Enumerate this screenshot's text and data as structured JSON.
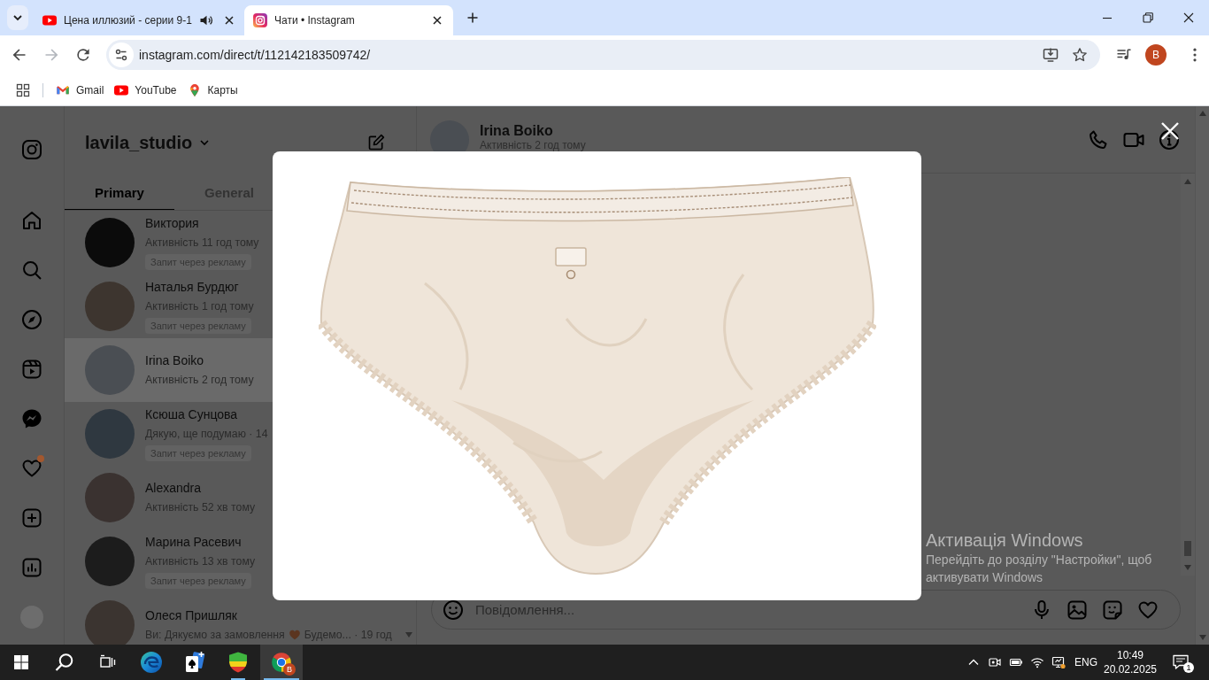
{
  "browser": {
    "tabs": [
      {
        "title": "Цена иллюзий - серии 9-1",
        "kind": "video",
        "audio": true,
        "selected": false
      },
      {
        "title": "Чати • Instagram",
        "kind": "photo",
        "audio": false,
        "selected": true
      }
    ],
    "nav": [
      {
        "kind": "back",
        "disabled": false
      },
      {
        "kind": "forward",
        "disabled": true
      },
      {
        "kind": "reload",
        "disabled": false
      }
    ],
    "address": "instagram.com/direct/t/112142183509742/",
    "profile_initial": "B",
    "bookmarks": [
      {
        "label": "Gmail",
        "kind": "mail"
      },
      {
        "label": "YouTube",
        "kind": "video"
      },
      {
        "label": "Карты",
        "kind": "map"
      }
    ]
  },
  "instagram": {
    "nav": [
      {
        "kind": "logo",
        "dot": false
      },
      {
        "kind": "home",
        "dot": false
      },
      {
        "kind": "search",
        "dot": false
      },
      {
        "kind": "explore",
        "dot": false
      },
      {
        "kind": "reels",
        "dot": false
      },
      {
        "kind": "messages",
        "dot": false
      },
      {
        "kind": "notifications",
        "dot": true
      },
      {
        "kind": "create",
        "dot": false
      },
      {
        "kind": "insights",
        "dot": false
      },
      {
        "kind": "profile",
        "dot": false
      }
    ],
    "account": "lavila_studio",
    "tabs": [
      {
        "label": "Primary",
        "selected": true
      },
      {
        "label": "General",
        "selected": false
      }
    ],
    "chats": [
      {
        "name": "Виктория",
        "preview": [
          {
            "kind": "text",
            "text": "Активність 11 год тому"
          }
        ],
        "tag": "Запит через рекламу",
        "selected": false
      },
      {
        "name": "Наталья Бурдюг",
        "preview": [
          {
            "kind": "text",
            "text": "Активність 1 год тому"
          }
        ],
        "tag": "Запит через рекламу",
        "selected": false
      },
      {
        "name": "Irina Boiko",
        "preview": [
          {
            "kind": "text",
            "text": "Активність 2 год тому"
          }
        ],
        "selected": true
      },
      {
        "name": "Ксюша Сунцова",
        "preview": [
          {
            "kind": "text",
            "text": "Дякую, ще подумаю · 14"
          }
        ],
        "tag": "Запит через рекламу",
        "selected": false
      },
      {
        "name": "Alexandra",
        "preview": [
          {
            "kind": "text",
            "text": "Активність 52 хв тому"
          }
        ],
        "selected": false
      },
      {
        "name": "Марина Расевич",
        "preview": [
          {
            "kind": "text",
            "text": "Активність 13 хв тому"
          }
        ],
        "tag": "Запит через рекламу",
        "selected": false
      },
      {
        "name": "Олеся Пришляк",
        "preview": [
          {
            "kind": "text",
            "text": "Ви: Дякуємо за замовлення"
          },
          {
            "kind": "emoji"
          },
          {
            "kind": "text",
            "text": "Будемо... · 19 год"
          }
        ],
        "selected": false
      }
    ],
    "conversation": {
      "name": "Irina Boiko",
      "status": "Активність 2 год тому",
      "placeholder": "Повідомлення..."
    }
  },
  "windows_notice": {
    "title": "Активація Windows",
    "text": "Перейдіть до розділу \"Настройки\", щоб активувати Windows"
  },
  "taskbar": {
    "apps": [
      {
        "kind": "start",
        "running": false,
        "selected": false
      },
      {
        "kind": "search",
        "running": false,
        "selected": false
      },
      {
        "kind": "task_view",
        "running": false,
        "selected": false
      },
      {
        "kind": "swirl",
        "running": false,
        "selected": false
      },
      {
        "kind": "cards",
        "running": false,
        "selected": false
      },
      {
        "kind": "shield",
        "running": true,
        "selected": false
      },
      {
        "kind": "tricolor",
        "running": true,
        "selected": true,
        "badge": "B"
      }
    ],
    "tray": [
      {
        "kind": "chevron"
      },
      {
        "kind": "camera"
      },
      {
        "kind": "battery"
      },
      {
        "kind": "wifi"
      },
      {
        "kind": "monitor"
      }
    ],
    "language": "ENG",
    "time": "10:49",
    "date": "20.02.2025",
    "notifications": "1"
  }
}
